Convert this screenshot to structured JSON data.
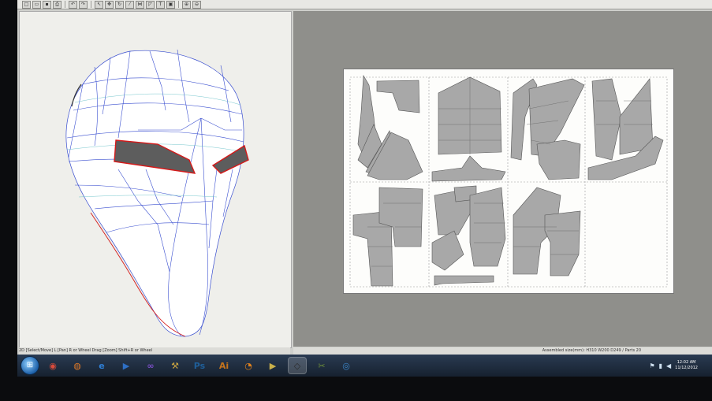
{
  "toolbar": {
    "buttons": [
      {
        "name": "new-icon",
        "glyph": "□"
      },
      {
        "name": "open-icon",
        "glyph": "▭"
      },
      {
        "name": "save-icon",
        "glyph": "▪"
      },
      {
        "name": "print-icon",
        "glyph": "⎙"
      },
      {
        "name": "undo-icon",
        "glyph": "↶"
      },
      {
        "name": "redo-icon",
        "glyph": "↷"
      },
      {
        "name": "select-icon",
        "glyph": "↖"
      },
      {
        "name": "move-icon",
        "glyph": "✥"
      },
      {
        "name": "rotate-icon",
        "glyph": "↻"
      },
      {
        "name": "edge-icon",
        "glyph": "⁄"
      },
      {
        "name": "join-icon",
        "glyph": "⋈"
      },
      {
        "name": "flap-icon",
        "glyph": "◸"
      },
      {
        "name": "text-icon",
        "glyph": "T"
      },
      {
        "name": "image-icon",
        "glyph": "▣"
      },
      {
        "name": "zoom-in-icon",
        "glyph": "⊕"
      },
      {
        "name": "zoom-out-icon",
        "glyph": "⊖"
      }
    ]
  },
  "status": {
    "left": "2D [Select/Move] L [Pan] R or Wheel Drag [Zoom] Shift+R or Wheel",
    "right": "Assembled size(mm): H310 W200 D249 / Parts 20"
  },
  "taskbar": {
    "apps": [
      {
        "name": "chrome-icon",
        "glyph": "◉",
        "color": "#d94b3b",
        "active": false
      },
      {
        "name": "firefox-icon",
        "glyph": "◍",
        "color": "#e07a28",
        "active": false
      },
      {
        "name": "ie-icon",
        "glyph": "e",
        "color": "#2f7fd6",
        "active": false
      },
      {
        "name": "media-player-icon",
        "glyph": "▶",
        "color": "#2e6fc4",
        "active": false
      },
      {
        "name": "visual-studio-icon",
        "glyph": "∞",
        "color": "#7b4fc9",
        "active": false
      },
      {
        "name": "tools-icon",
        "glyph": "⚒",
        "color": "#c9a441",
        "active": false
      },
      {
        "name": "photoshop-icon",
        "glyph": "Ps",
        "color": "#1f5f9a",
        "active": false
      },
      {
        "name": "illustrator-icon",
        "glyph": "Ai",
        "color": "#c4731c",
        "active": false
      },
      {
        "name": "blender-icon",
        "glyph": "◔",
        "color": "#e0821e",
        "active": false
      },
      {
        "name": "video-icon",
        "glyph": "▶",
        "color": "#c9b04a",
        "active": false
      },
      {
        "name": "pepakura-icon",
        "glyph": "◇",
        "color": "#2b2b2b",
        "active": true
      },
      {
        "name": "cut-icon",
        "glyph": "✂",
        "color": "#6b8b3a",
        "active": false
      },
      {
        "name": "globe-icon",
        "glyph": "◎",
        "color": "#3b86c8",
        "active": false
      }
    ],
    "clock_time": "12:02 AM",
    "clock_date": "11/12/2012"
  }
}
